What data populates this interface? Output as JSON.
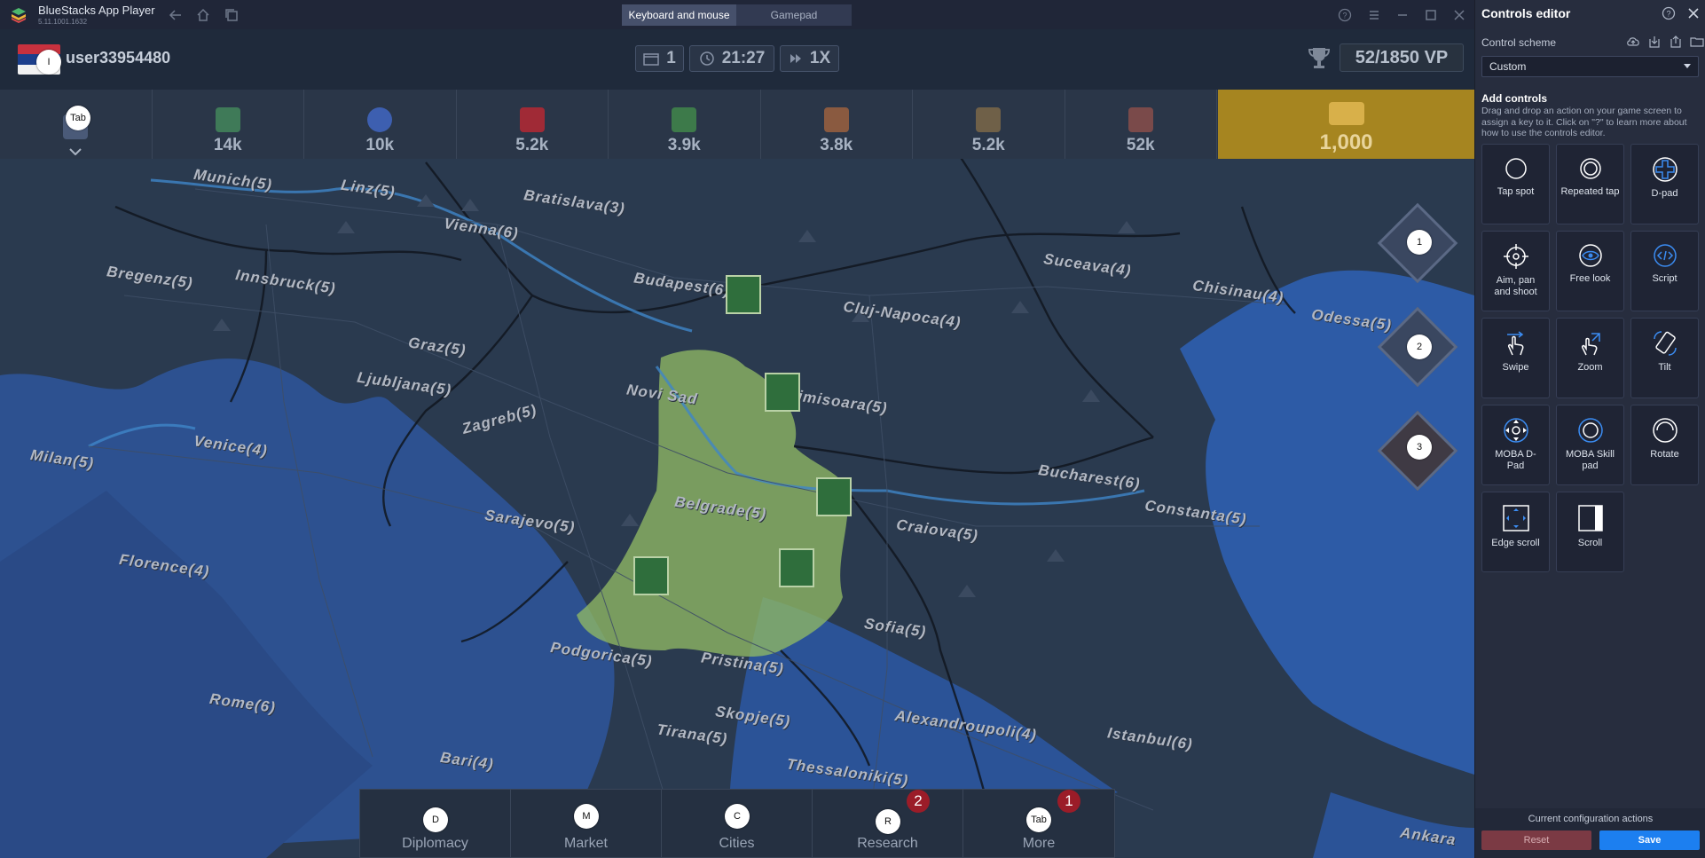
{
  "window": {
    "app_title": "BlueStacks App Player",
    "app_version": "5.11.1001.1632",
    "tabs": [
      {
        "label": "Keyboard and mouse",
        "active": true
      },
      {
        "label": "Gamepad",
        "active": false
      }
    ]
  },
  "game": {
    "username": "user33954480",
    "username_key": "I",
    "turn": "1",
    "time": "21:27",
    "speed": "1X",
    "victory_points": "52/1850 VP",
    "resources_key": "Tab",
    "resources": [
      "14k",
      "10k",
      "5.2k",
      "3.9k",
      "3.8k",
      "5.2k",
      "52k"
    ],
    "gold": "1,000",
    "side_buttons": [
      {
        "key": "1",
        "icon": "army-icon"
      },
      {
        "key": "2",
        "icon": "flag-icon"
      },
      {
        "key": "3",
        "icon": "general-portrait"
      }
    ],
    "cities": [
      {
        "name": "Munich(5)"
      },
      {
        "name": "Linz(5)"
      },
      {
        "name": "Bratislava(3)"
      },
      {
        "name": "Vienna(6)"
      },
      {
        "name": "Innsbruck(5)"
      },
      {
        "name": "Bregenz(5)"
      },
      {
        "name": "Budapest(6)"
      },
      {
        "name": "Graz(5)"
      },
      {
        "name": "Cluj-Napoca(4)"
      },
      {
        "name": "Suceava(4)"
      },
      {
        "name": "Chisinau(4)"
      },
      {
        "name": "Odessa(5)"
      },
      {
        "name": "Ljubljana(5)"
      },
      {
        "name": "Zagreb(5)"
      },
      {
        "name": "Novi Sad"
      },
      {
        "name": "Timisoara(5)"
      },
      {
        "name": "Venice(4)"
      },
      {
        "name": "Milan(5)"
      },
      {
        "name": "Bucharest(6)"
      },
      {
        "name": "Constanta(5)"
      },
      {
        "name": "Belgrade(5)"
      },
      {
        "name": "Sarajevo(5)"
      },
      {
        "name": "Craiova(5)"
      },
      {
        "name": "Florence(4)"
      },
      {
        "name": "Sofia(5)"
      },
      {
        "name": "Podgorica(5)"
      },
      {
        "name": "Pristina(5)"
      },
      {
        "name": "Rome(6)"
      },
      {
        "name": "Skopje(5)"
      },
      {
        "name": "Tirana(5)"
      },
      {
        "name": "Alexandroupoli(4)"
      },
      {
        "name": "Istanbul(6)"
      },
      {
        "name": "Bari(4)"
      },
      {
        "name": "Thessaloniki(5)"
      },
      {
        "name": "Ankara"
      }
    ],
    "bottom_nav": [
      {
        "key": "D",
        "label": "Diplomacy",
        "icon": "dove-icon",
        "badge": ""
      },
      {
        "key": "M",
        "label": "Market",
        "icon": "market-icon",
        "badge": ""
      },
      {
        "key": "C",
        "label": "Cities",
        "icon": "city-icon",
        "badge": ""
      },
      {
        "key": "R",
        "label": "Research",
        "icon": "flask-icon",
        "badge": "2"
      },
      {
        "key": "Tab",
        "label": "More",
        "icon": "menu-icon",
        "badge": "1"
      }
    ],
    "colors": {
      "hud": "#1f2a3b",
      "gold_cell": "#a68520",
      "territory": "#8fb864",
      "sea": "#2d5ba6",
      "badge": "#9b1c28"
    }
  },
  "panel": {
    "title": "Controls editor",
    "scheme_label": "Control scheme",
    "scheme_value": "Custom",
    "add_title": "Add controls",
    "add_desc": "Drag and drop an action on your game screen to assign a key to it. Click on \"?\" to learn more about how to use the controls editor.",
    "controls": [
      {
        "label": "Tap spot",
        "icon": "tap-spot-icon"
      },
      {
        "label": "Repeated tap",
        "icon": "repeated-tap-icon"
      },
      {
        "label": "D-pad",
        "icon": "dpad-icon"
      },
      {
        "label": "Aim, pan and shoot",
        "icon": "crosshair-icon"
      },
      {
        "label": "Free look",
        "icon": "eye-icon"
      },
      {
        "label": "Script",
        "icon": "code-icon"
      },
      {
        "label": "Swipe",
        "icon": "swipe-icon"
      },
      {
        "label": "Zoom",
        "icon": "zoom-icon"
      },
      {
        "label": "Tilt",
        "icon": "tilt-icon"
      },
      {
        "label": "MOBA D-Pad",
        "icon": "moba-dpad-icon"
      },
      {
        "label": "MOBA Skill pad",
        "icon": "moba-skill-icon"
      },
      {
        "label": "Rotate",
        "icon": "rotate-icon"
      },
      {
        "label": "Edge scroll",
        "icon": "edge-scroll-icon"
      },
      {
        "label": "Scroll",
        "icon": "scroll-icon"
      }
    ],
    "config_title": "Current configuration actions",
    "reset_label": "Reset",
    "save_label": "Save",
    "colors": {
      "accent": "#1c7ff0",
      "reset": "#7b3a44"
    }
  }
}
